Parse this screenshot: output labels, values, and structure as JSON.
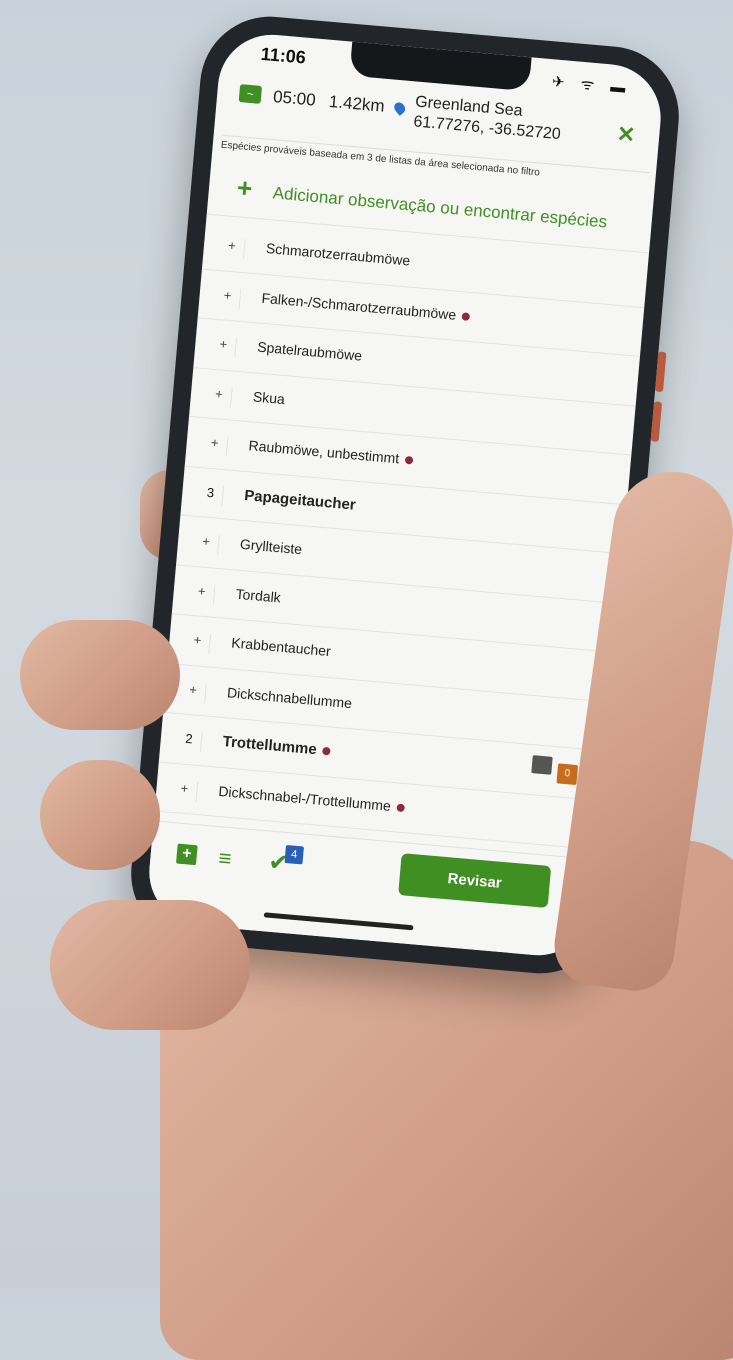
{
  "status": {
    "time": "11:06",
    "icons": "✈ ᯤ ▬"
  },
  "header": {
    "trip_time": "05:00",
    "trip_distance": "1.42km",
    "location_name": "Greenland Sea",
    "location_coords": "61.77276, -36.52720",
    "map_icon": "map-icon",
    "close_icon": "close-icon"
  },
  "subtitle": "Espécies prováveis baseada em 3 de listas da área selecionada no filtro",
  "add_observation": {
    "plus": "+",
    "label": "Adicionar observação ou encontrar espécies"
  },
  "species": [
    {
      "count": "+",
      "name": "Schmarotzerraubmöwe",
      "dot": false,
      "observed": false
    },
    {
      "count": "+",
      "name": "Falken-/Schmarotzerraubmöwe",
      "dot": true,
      "observed": false
    },
    {
      "count": "+",
      "name": "Spatelraubmöwe",
      "dot": false,
      "observed": false
    },
    {
      "count": "+",
      "name": "Skua",
      "dot": false,
      "observed": false
    },
    {
      "count": "+",
      "name": "Raubmöwe, unbestimmt",
      "dot": true,
      "observed": false
    },
    {
      "count": "3",
      "name": "Papageitaucher",
      "dot": false,
      "observed": true
    },
    {
      "count": "+",
      "name": "Gryllteiste",
      "dot": false,
      "observed": false
    },
    {
      "count": "+",
      "name": "Tordalk",
      "dot": false,
      "observed": false
    },
    {
      "count": "+",
      "name": "Krabbentaucher",
      "dot": false,
      "observed": false
    },
    {
      "count": "+",
      "name": "Dickschnabellumme",
      "dot": false,
      "observed": false
    },
    {
      "count": "2",
      "name": "Trottellumme",
      "dot": true,
      "observed": true
    },
    {
      "count": "+",
      "name": "Dickschnabel-/Trottellumme",
      "dot": true,
      "observed": false
    }
  ],
  "media_badge": "0",
  "toolbar": {
    "checklist_badge": "4",
    "review_label": "Revisar"
  },
  "colors": {
    "accent": "#3f8f22",
    "pin": "#2d6fd1",
    "dot": "#8b2b3c"
  }
}
